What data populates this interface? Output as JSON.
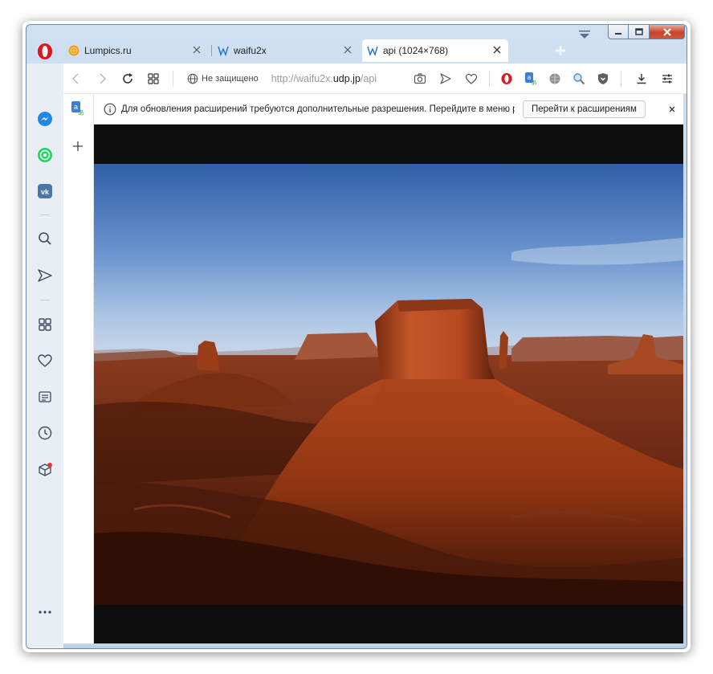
{
  "browser": {
    "tabs": [
      {
        "title": "Lumpics.ru",
        "favicon": "orange-icon"
      },
      {
        "title": "waifu2x",
        "favicon": "w-icon"
      },
      {
        "title": "api (1024×768)",
        "favicon": "w-icon",
        "active": true
      }
    ],
    "address": {
      "security_label": "Не защищено",
      "url_prefix": "http://waifu2x.",
      "url_domain": "udp.jp",
      "url_path": "/api"
    }
  },
  "notification": {
    "text": "Для обновления расширений требуются дополнительные разрешения. Перейдите в меню расширений.",
    "button_label": "Перейти к расширениям"
  },
  "colors": {
    "opera_red": "#e0141e",
    "messenger_blue": "#1e88e5",
    "whatsapp_green": "#25d366",
    "vk_blue": "#4a76a8",
    "sky_top": "#2f5fa8",
    "rock": "#b2471c"
  }
}
